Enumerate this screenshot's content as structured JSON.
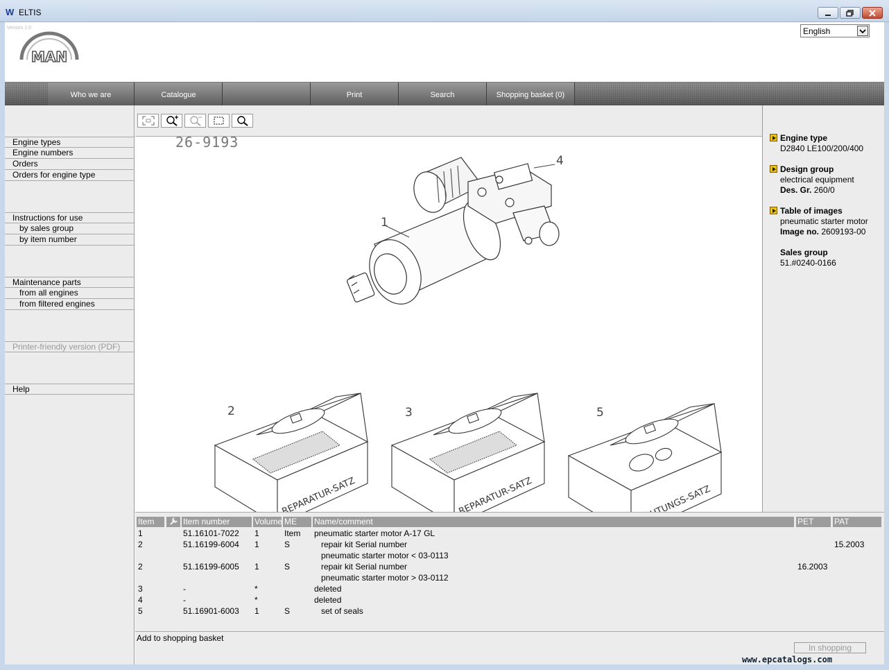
{
  "window": {
    "title": "ELTIS"
  },
  "header": {
    "version": "Version 1.0",
    "logo_text": "MAN",
    "language": "English"
  },
  "nav": [
    "Who we are",
    "Catalogue",
    "",
    "Print",
    "Search",
    "Shopping basket (0)"
  ],
  "sidebar": {
    "engine_types": "Engine types",
    "engine_numbers": "Engine numbers",
    "orders": "Orders",
    "orders_for_engine_type": "Orders for engine type",
    "instructions_for_use": "Instructions for use",
    "by_sales_group": "by sales group",
    "by_item_number": "by item number",
    "maintenance_parts": "Maintenance parts",
    "from_all_engines": "from all engines",
    "from_filtered_engines": "from filtered engines",
    "printer_friendly": "Printer-friendly version (PDF)",
    "help": "Help"
  },
  "toolbar": {
    "icons": [
      "fit-to-page-icon",
      "zoom-in-icon",
      "zoom-out-icon",
      "select-area-icon",
      "magnifier-icon"
    ]
  },
  "drawing": {
    "image_ref": "26-9193",
    "callouts": [
      "1",
      "2",
      "3",
      "4",
      "5"
    ],
    "box_labels": [
      "REPARATUR-SATZ",
      "REPARATUR-SATZ",
      "DICHTUNGS-SATZ"
    ]
  },
  "info": {
    "engine_type_head": "Engine type",
    "engine_type": "D2840 LE100/200/400",
    "design_group_head": "Design group",
    "design_group": "electrical equipment",
    "des_gr_label": "Des. Gr.",
    "des_gr_value": "260/0",
    "table_of_images_head": "Table of images",
    "table_of_images": "pneumatic starter motor",
    "image_no_label": "Image no.",
    "image_no_value": "2609193-00",
    "sales_group_head": "Sales group",
    "sales_group": "51.#0240-0166"
  },
  "parts": {
    "headers": [
      "Item",
      "",
      "Item number",
      "Volume",
      "ME",
      "Name/comment",
      "PET",
      "PAT"
    ],
    "rows": [
      {
        "item": "1",
        "number": "51.16101-7022",
        "volume": "1",
        "me": "Item",
        "name": "pneumatic starter motor A-17 GL",
        "pet": "",
        "pat": ""
      },
      {
        "item": "2",
        "number": "51.16199-6004",
        "volume": "1",
        "me": "S",
        "name": "repair kit Serial number",
        "pet": "",
        "pat": "15.2003"
      },
      {
        "item": "",
        "number": "",
        "volume": "",
        "me": "",
        "name": "pneumatic starter motor < 03-0113",
        "pet": "",
        "pat": ""
      },
      {
        "item": "2",
        "number": "51.16199-6005",
        "volume": "1",
        "me": "S",
        "name": "repair kit Serial number",
        "pet": "16.2003",
        "pat": ""
      },
      {
        "item": "",
        "number": "",
        "volume": "",
        "me": "",
        "name": "pneumatic starter motor > 03-0112",
        "pet": "",
        "pat": ""
      },
      {
        "item": "3",
        "number": "-",
        "volume": "*",
        "me": "",
        "name": "deleted",
        "pet": "",
        "pat": ""
      },
      {
        "item": "4",
        "number": "-",
        "volume": "*",
        "me": "",
        "name": "deleted",
        "pet": "",
        "pat": ""
      },
      {
        "item": "5",
        "number": "51.16901-6003",
        "volume": "1",
        "me": "S",
        "name": "set of seals",
        "pet": "",
        "pat": ""
      }
    ]
  },
  "basket": {
    "label": "Add to shopping basket",
    "button": "In shopping"
  },
  "watermark": "www.epcatalogs.com"
}
